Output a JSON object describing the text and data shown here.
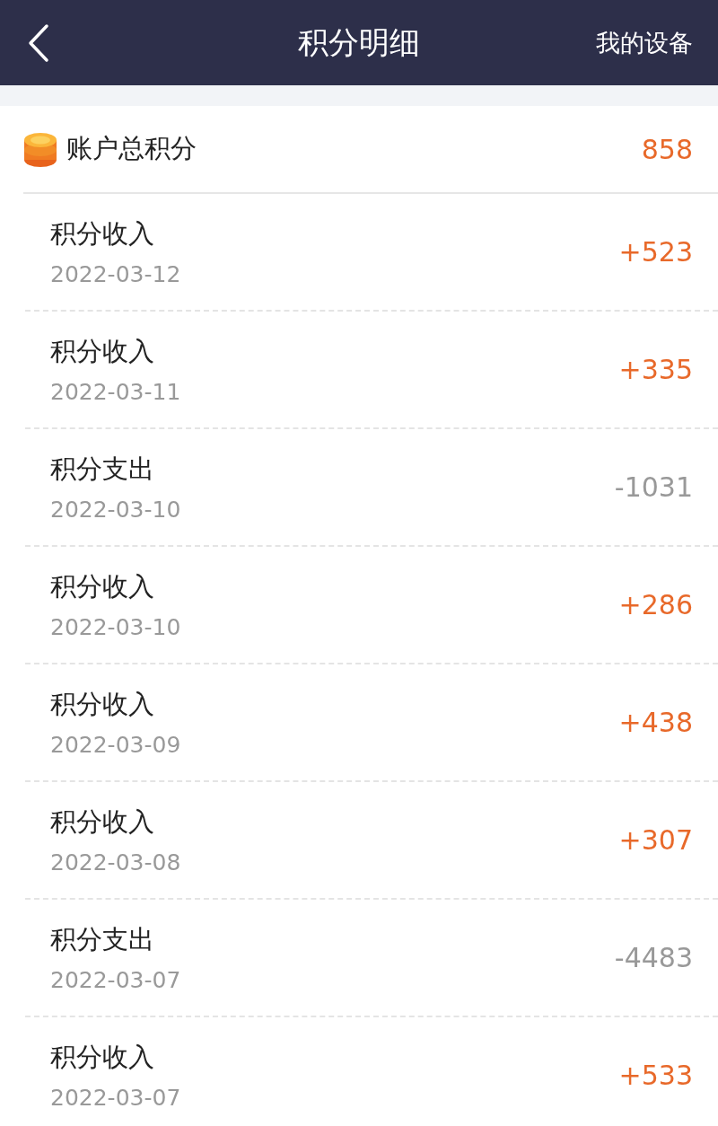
{
  "header": {
    "title": "积分明细",
    "action": "我的设备"
  },
  "total": {
    "label": "账户总积分",
    "value": "858"
  },
  "records": [
    {
      "kind": "income",
      "title": "积分收入",
      "date": "2022-03-12",
      "amount": "+523"
    },
    {
      "kind": "income",
      "title": "积分收入",
      "date": "2022-03-11",
      "amount": "+335"
    },
    {
      "kind": "expense",
      "title": "积分支出",
      "date": "2022-03-10",
      "amount": "-1031"
    },
    {
      "kind": "income",
      "title": "积分收入",
      "date": "2022-03-10",
      "amount": "+286"
    },
    {
      "kind": "income",
      "title": "积分收入",
      "date": "2022-03-09",
      "amount": "+438"
    },
    {
      "kind": "income",
      "title": "积分收入",
      "date": "2022-03-08",
      "amount": "+307"
    },
    {
      "kind": "expense",
      "title": "积分支出",
      "date": "2022-03-07",
      "amount": "-4483"
    },
    {
      "kind": "income",
      "title": "积分收入",
      "date": "2022-03-07",
      "amount": "+533"
    }
  ]
}
